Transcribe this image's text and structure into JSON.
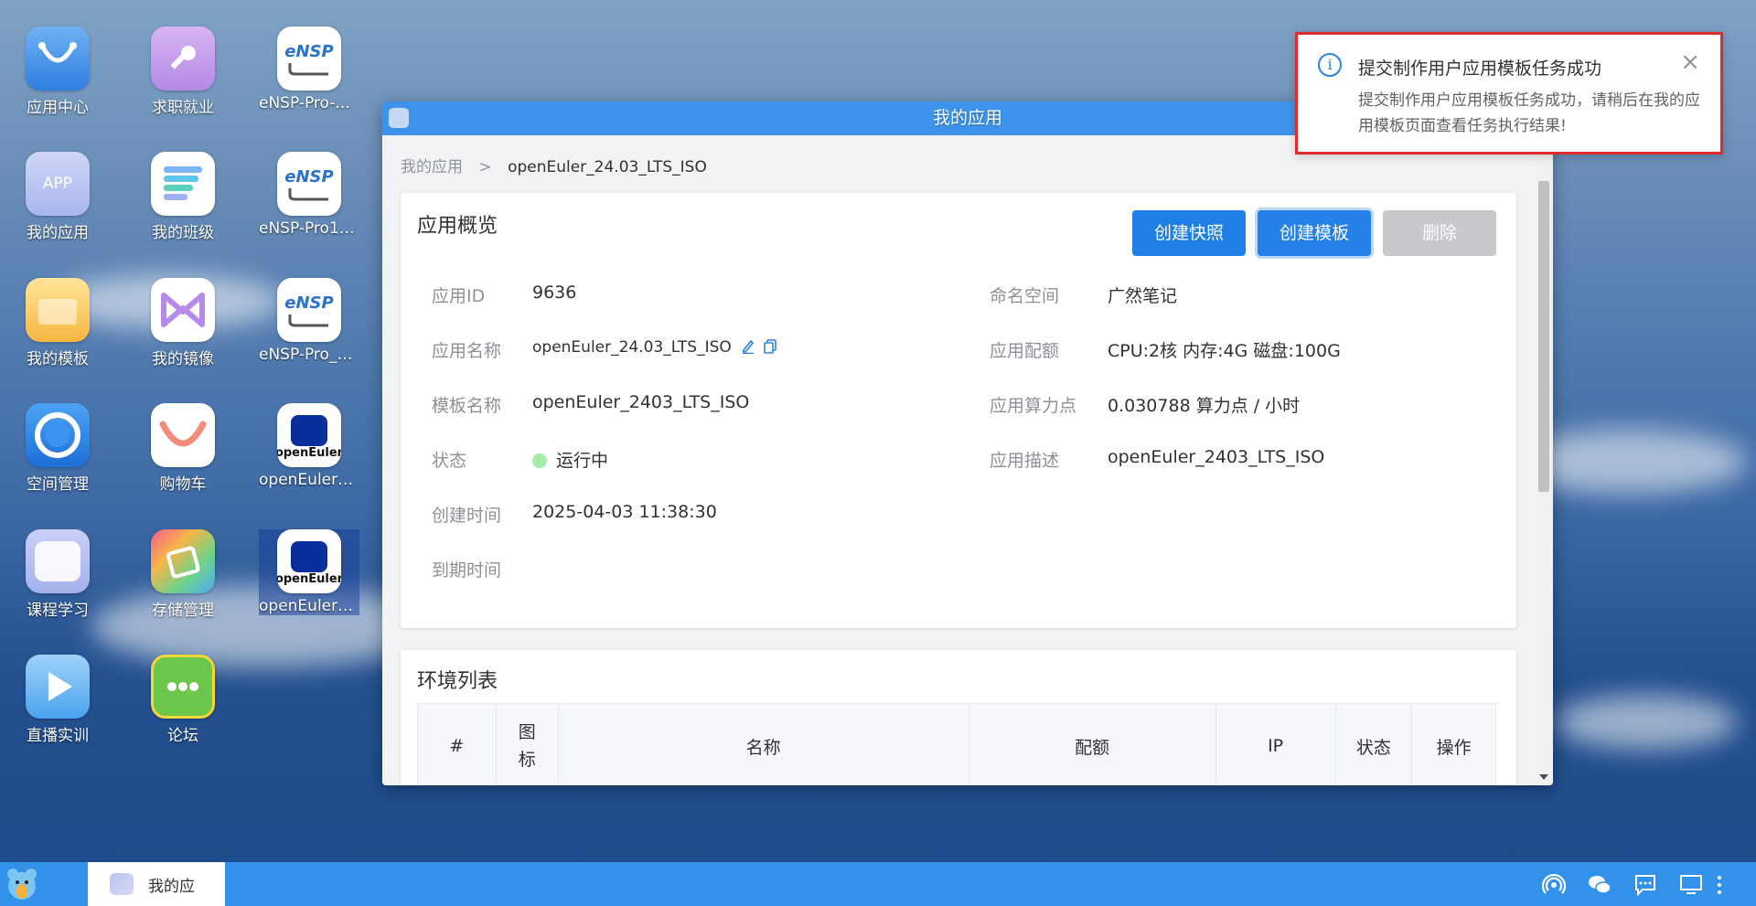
{
  "desktop": {
    "icons": [
      {
        "label": "应用中心",
        "icon": "shopping-bag-icon"
      },
      {
        "label": "求职就业",
        "icon": "key-icon"
      },
      {
        "label": "eNSP-Pro-v1...",
        "icon": "ensp-icon"
      },
      {
        "label": "我的应用",
        "icon": "app-icon"
      },
      {
        "label": "我的班级",
        "icon": "class-list-icon"
      },
      {
        "label": "eNSP-Pro1.2...",
        "icon": "ensp-icon"
      },
      {
        "label": "我的模板",
        "icon": "folder-icon"
      },
      {
        "label": "我的镜像",
        "icon": "mirror-icon"
      },
      {
        "label": "eNSP-Pro_v1...",
        "icon": "ensp-icon"
      },
      {
        "label": "空间管理",
        "icon": "space-icon"
      },
      {
        "label": "购物车",
        "icon": "cart-icon"
      },
      {
        "label": "openEuler_2...",
        "icon": "openeuler-icon"
      },
      {
        "label": "课程学习",
        "icon": "course-icon"
      },
      {
        "label": "存储管理",
        "icon": "storage-icon"
      },
      {
        "label": "openEuler_2...",
        "icon": "openeuler-icon"
      },
      {
        "label": "直播实训",
        "icon": "live-play-icon"
      },
      {
        "label": "论坛",
        "icon": "forum-chat-icon"
      }
    ],
    "ensp_text": "eNSP",
    "openeuler_text": "openEuler"
  },
  "window": {
    "title": "我的应用",
    "breadcrumb": {
      "parent": "我的应用",
      "separator": ">",
      "current": "openEuler_24.03_LTS_ISO"
    },
    "overview": {
      "title": "应用概览",
      "buttons": {
        "snapshot": "创建快照",
        "template": "创建模板",
        "delete": "删除"
      },
      "left": [
        {
          "label": "应用ID",
          "value": "9636"
        },
        {
          "label": "应用名称",
          "value": "openEuler_24.03_LTS_ISO"
        },
        {
          "label": "模板名称",
          "value": "openEuler_2403_LTS_ISO"
        },
        {
          "label": "状态",
          "value": "运行中"
        },
        {
          "label": "创建时间",
          "value": "2025-04-03 11:38:30"
        },
        {
          "label": "到期时间",
          "value": ""
        }
      ],
      "right": [
        {
          "label": "命名空间",
          "value": "广然笔记"
        },
        {
          "label": "应用配额",
          "value": "CPU:2核 内存:4G 磁盘:100G"
        },
        {
          "label": "应用算力点",
          "value": "0.030788 算力点 / 小时"
        },
        {
          "label": "应用描述",
          "value": "openEuler_2403_LTS_ISO"
        }
      ]
    },
    "env": {
      "title": "环境列表",
      "columns": [
        "#",
        "图标",
        "名称",
        "配额",
        "IP",
        "状态",
        "操作"
      ]
    }
  },
  "notification": {
    "title": "提交制作用户应用模板任务成功",
    "message": "提交制作用户应用模板任务成功，请稍后在我的应用模板页面查看任务执行结果!",
    "icon": "info-icon",
    "close": "×",
    "info_glyph": "i"
  },
  "taskbar": {
    "task_label": "我的应",
    "tray_icons": [
      "broadcast-icon",
      "wechat-icon",
      "chat-icon",
      "monitor-icon",
      "more-icon"
    ]
  },
  "colors": {
    "accent": "#3d94ea",
    "primary_button": "#1e80e6",
    "status_running": "#a6ecab",
    "notice_border": "#e02b2b"
  }
}
